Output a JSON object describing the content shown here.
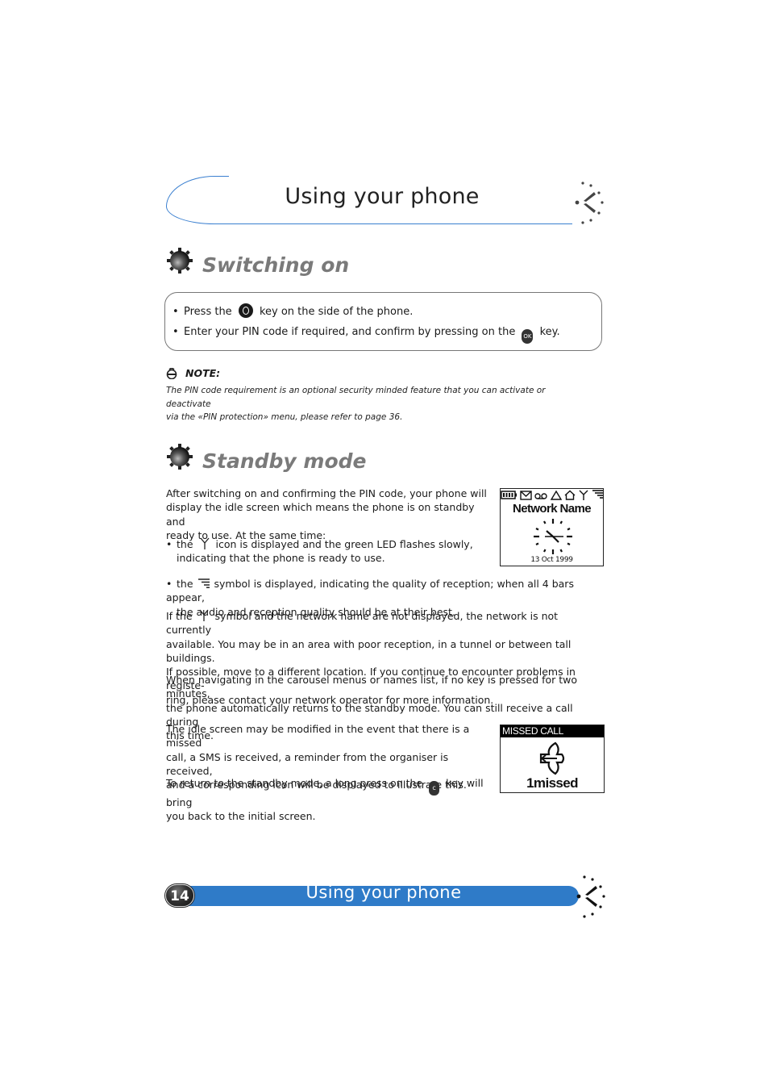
{
  "header": {
    "title": "Using your phone"
  },
  "sections": {
    "switching_on": {
      "title": "Switching on",
      "bullets": [
        {
          "before": "Press the",
          "key": "power-key",
          "after": "key on the side of the phone."
        },
        {
          "before": "Enter your PIN code if required, and confirm by pressing on the",
          "key": "ok-key",
          "key_label": "OK",
          "after": "key."
        }
      ],
      "note": {
        "label": "NOTE:",
        "line1": "The PIN code requirement is an optional security minded feature that you can activate or deactivate",
        "line2": "via the «PIN protection» menu, please refer to page 36."
      }
    },
    "standby_mode": {
      "title": "Standby mode",
      "intro": [
        "After switching on and confirming the PIN code, your phone will",
        "display the idle screen which means the phone is on standby and",
        "ready to use.  At the same time:"
      ],
      "bullet1": {
        "before": "the",
        "after": "icon is displayed and the green LED flashes slowly,",
        "line2": "indicating that the phone is ready to use."
      },
      "bullet2": {
        "before": "the",
        "after": "symbol is displayed, indicating the quality of reception; when all 4 bars appear,",
        "line2": "the audio and reception quality should be at their best."
      },
      "para_network": {
        "before": "If the",
        "after": "symbol and the network name are not displayed, the network is not currently",
        "line2": "available.  You may be in an area with poor reception, in a tunnel or between tall buildings.",
        "line3": "If  possible, move to a different location.  If you continue to encounter problems in registe-",
        "line4": "ring, please contact your network operator for more information."
      },
      "para_timeout": [
        "When navigating in the carousel menus or names list, if no key is pressed for two minutes,",
        "the phone automatically returns to the standby mode.  You can still receive a call during",
        "this time."
      ],
      "para_idle": [
        "The idle screen may be modified in the event that there is a missed",
        "call, a SMS is received, a reminder from the organiser is received,",
        "and a corresponding icon will be displayed to illustrate this."
      ],
      "para_return": {
        "before": "To return to the standby mode, a long press on the",
        "key_label": "c",
        "after": "key will bring",
        "line2": "you back to the initial screen."
      }
    }
  },
  "idle_screen": {
    "status_icons": [
      "battery-icon",
      "envelope-icon",
      "voicemail-icon",
      "alarm-icon",
      "home-icon",
      "antenna-icon",
      "signal-bars-icon"
    ],
    "network_name": "Network Name",
    "date": "13 Oct 1999"
  },
  "missed_call_screen": {
    "header": "MISSED CALL",
    "count_text": "1missed"
  },
  "footer": {
    "page_number": "14",
    "title": "Using your phone"
  },
  "colors": {
    "accent_blue": "#2f7bc8",
    "heading_gray": "#7a7a7a",
    "line_blue": "#3a7fd0"
  }
}
